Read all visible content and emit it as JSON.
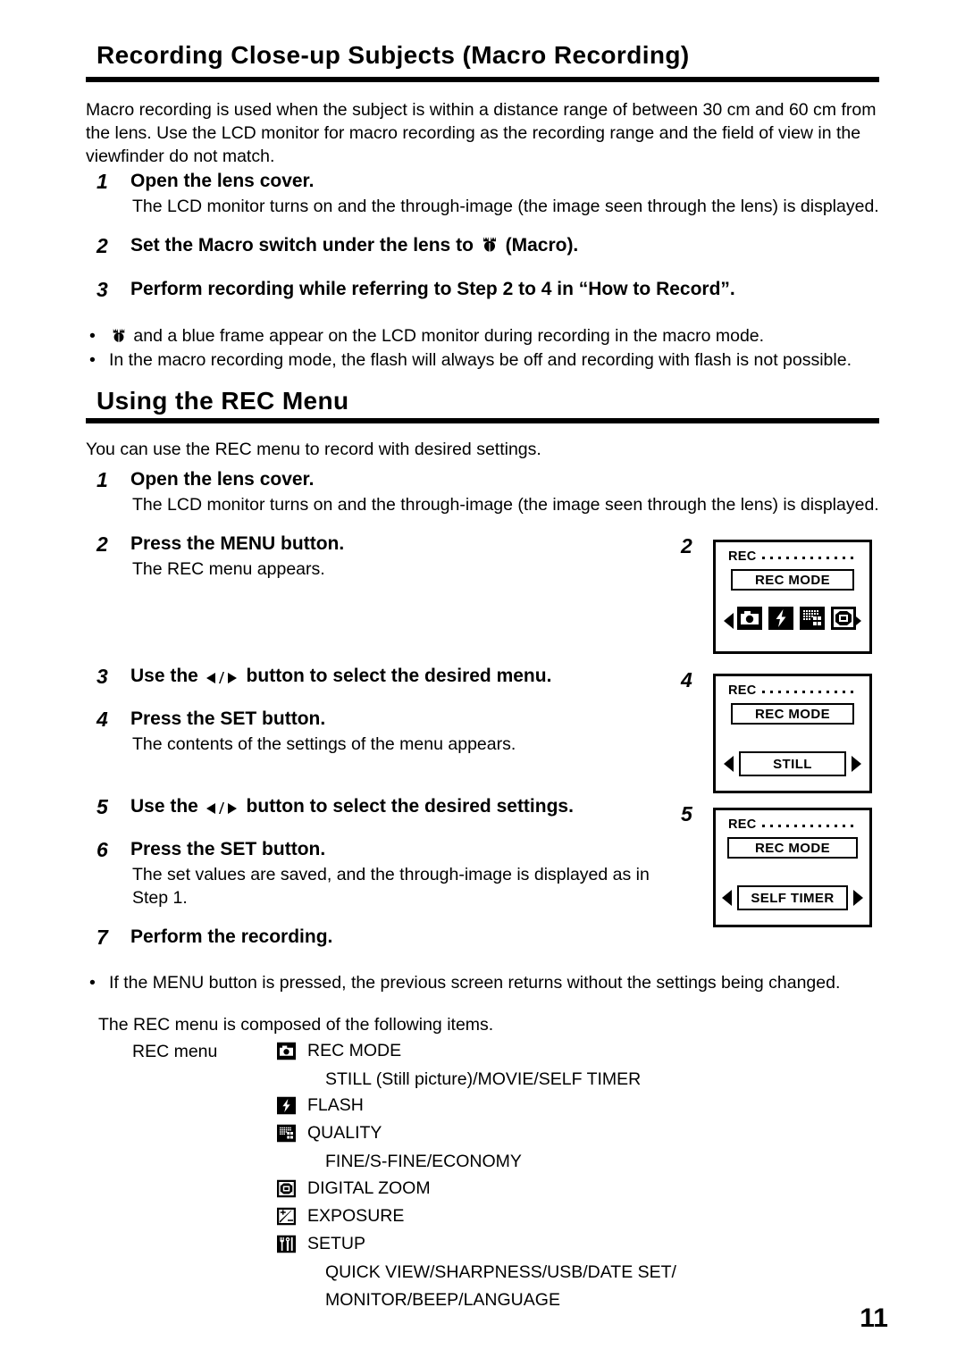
{
  "document": {
    "page_number": "11"
  },
  "section1": {
    "title": "Recording Close-up Subjects (Macro Recording)",
    "intro": "Macro recording is used when the subject is within a distance range of between 30 cm and 60 cm from the lens. Use the LCD monitor for macro recording as the recording range and the field of view in the viewfinder do not match.",
    "steps": [
      {
        "num": "1",
        "head": "Open the lens cover.",
        "body": "The LCD monitor turns on and the through-image (the image seen through the lens) is displayed."
      },
      {
        "num": "2",
        "head_before": "Set the Macro switch under the lens to",
        "head_after": "(Macro).",
        "body": ""
      },
      {
        "num": "3",
        "head": "Perform recording while referring to Step 2 to 4 in “How to Record”.",
        "body": ""
      }
    ],
    "bullets": [
      "and a blue frame appear on the LCD monitor during recording in the macro mode.",
      "In the macro recording mode, the flash will always be off and recording with flash is not possible."
    ],
    "bullet_marker": "•"
  },
  "section2": {
    "title": "Using the REC Menu",
    "intro": "You can use the REC menu to record with desired settings.",
    "steps": [
      {
        "num": "1",
        "head": "Open the lens cover.",
        "body": "The LCD monitor turns on and the through-image (the image seen through the lens) is displayed."
      },
      {
        "num": "2",
        "head": "Press the MENU button.",
        "body": "The REC menu appears."
      },
      {
        "num": "3",
        "head_before": "Use the",
        "head_after": "button to select the desired menu.",
        "body": ""
      },
      {
        "num": "4",
        "head": "Press the SET button.",
        "body": "The contents of the settings of the menu appears."
      },
      {
        "num": "5",
        "head_before": "Use the",
        "head_after": "button to select the desired settings.",
        "body": ""
      },
      {
        "num": "6",
        "head": "Press the SET button.",
        "body": "The set values are saved, and the through-image is displayed as in Step 1."
      },
      {
        "num": "7",
        "head": "Perform the recording.",
        "body": ""
      }
    ],
    "bullets": [
      "If the MENU button is pressed, the previous screen returns without the settings being changed."
    ],
    "bullet_marker": "•",
    "closing": "The REC menu is composed of the following items."
  },
  "lcd_panels": [
    {
      "num": "2",
      "header": "REC",
      "field_label": "REC MODE",
      "mode": "icons",
      "icons": [
        "camera-icon",
        "flash-icon",
        "quality-grid-icon",
        "digital-zoom-icon"
      ]
    },
    {
      "num": "4",
      "header": "REC",
      "field_label": "REC MODE",
      "mode": "value",
      "value": "STILL"
    },
    {
      "num": "5",
      "header": "REC",
      "field_label": "REC MODE",
      "mode": "value",
      "value": "SELF TIMER"
    }
  ],
  "menu_listing": {
    "label": "REC menu",
    "items": [
      {
        "icon": "camera-icon",
        "label": "REC MODE",
        "sub": "STILL (Still picture)/MOVIE/SELF TIMER"
      },
      {
        "icon": "flash-icon",
        "label": "FLASH",
        "sub": ""
      },
      {
        "icon": "quality-grid-icon",
        "label": "QUALITY",
        "sub": "FINE/S-FINE/ECONOMY"
      },
      {
        "icon": "digital-zoom-icon",
        "label": "DIGITAL ZOOM",
        "sub": ""
      },
      {
        "icon": "exposure-icon",
        "label": "EXPOSURE",
        "sub": ""
      },
      {
        "icon": "setup-tools-icon",
        "label": "SETUP",
        "sub": "QUICK VIEW/SHARPNESS/USB/DATE SET/"
      },
      {
        "icon": "",
        "label": "",
        "sub": "MONITOR/BEEP/LANGUAGE"
      }
    ]
  },
  "colors": {
    "ink": "#000000",
    "paper": "#ffffff"
  }
}
